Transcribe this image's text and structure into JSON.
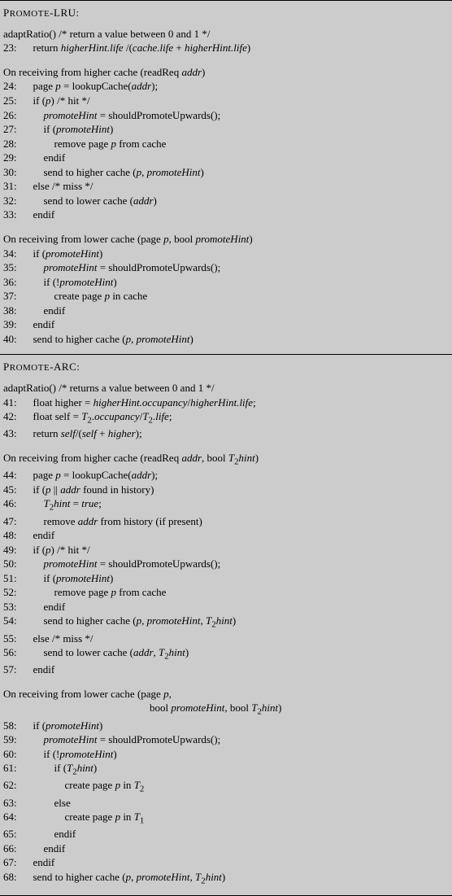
{
  "section1": {
    "title": "Promote-LRU:",
    "adaptHeader": "adaptRatio() /* return a value between 0 and 1 */",
    "l23": "return higherHint.life /(cache.life + higherHint.life)",
    "rxHigher": "On receiving from higher cache (readReq addr)",
    "l24": "page p = lookupCache(addr);",
    "l25": "if (p) /* hit */",
    "l26": "promoteHint = shouldPromoteUpwards();",
    "l27": "if (promoteHint)",
    "l28": "remove page p from cache",
    "l29": "endif",
    "l30": "send to higher cache (p, promoteHint)",
    "l31": "else /* miss */",
    "l32": "send to lower cache (addr)",
    "l33": "endif",
    "rxLower": "On receiving from lower cache (page p, bool promoteHint)",
    "l34": "if (promoteHint)",
    "l35": "promoteHint = shouldPromoteUpwards();",
    "l36": "if (!promoteHint)",
    "l37": "create page p in cache",
    "l38": "endif",
    "l39": "endif",
    "l40": "send to higher cache (p, promoteHint)"
  },
  "section2": {
    "title": "Promote-ARC:",
    "adaptHeader": "adaptRatio() /* returns a value between 0 and 1 */",
    "l41": "float higher = higherHint.occupancy/higherHint.life;",
    "l42": "float self = T2.occupancy/T2.life;",
    "l43": "return self/(self + higher);",
    "rxHigher": "On receiving from higher cache (readReq addr, bool T2hint)",
    "l44": "page p = lookupCache(addr);",
    "l45": "if (p || addr found in history)",
    "l46": "T2hint = true;",
    "l47": "remove addr from history (if present)",
    "l48": "endif",
    "l49": "if (p) /* hit */",
    "l50": "promoteHint = shouldPromoteUpwards();",
    "l51": "if (promoteHint)",
    "l52": "remove page p from cache",
    "l53": "endif",
    "l54": "send to higher cache (p, promoteHint, T2hint)",
    "l55": "else /* miss */",
    "l56": "send to lower cache (addr, T2hint)",
    "l57": "endif",
    "rxLower1": "On receiving from lower cache (page p,",
    "rxLower2": "bool promoteHint, bool T2hint)",
    "l58": "if (promoteHint)",
    "l59": "promoteHint = shouldPromoteUpwards();",
    "l60": "if (!promoteHint)",
    "l61": "if (T2hint)",
    "l62": "create page p in T2",
    "l63": "else",
    "l64": "create page p in T1",
    "l65": "endif",
    "l66": "endif",
    "l67": "endif",
    "l68": "send to higher cache (p, promoteHint, T2hint)"
  }
}
